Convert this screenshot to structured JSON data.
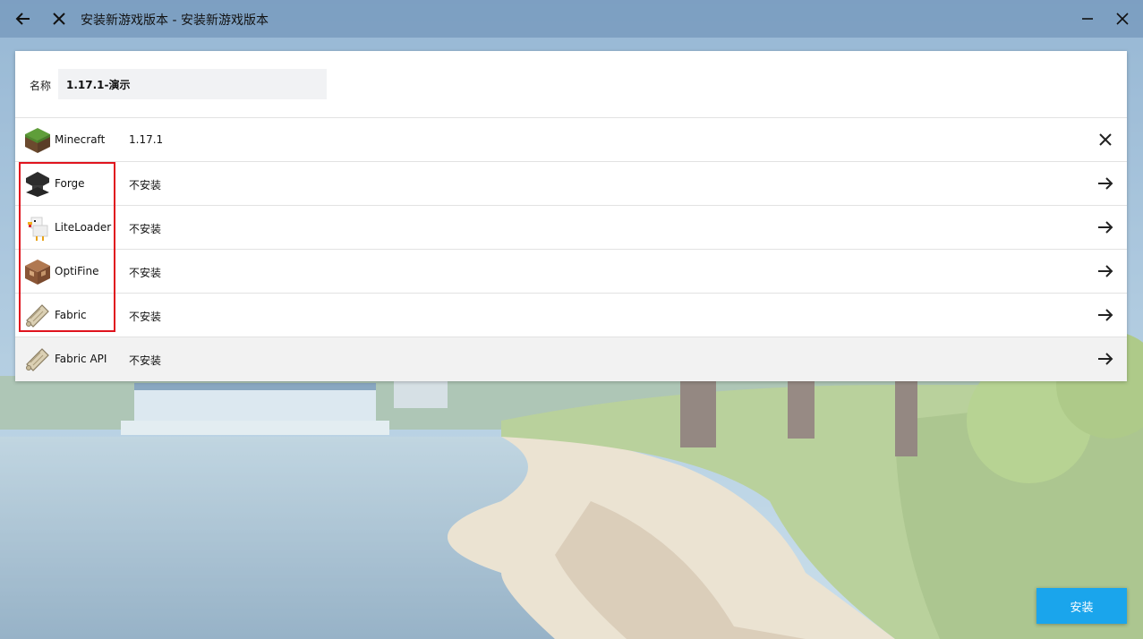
{
  "window": {
    "title": "安装新游戏版本 - 安装新游戏版本"
  },
  "icons": {
    "back": "arrow-left-icon",
    "close_window": "close-icon",
    "minimize": "minimize-icon",
    "close": "close-icon"
  },
  "name_field": {
    "label": "名称",
    "value": "1.17.1-演示"
  },
  "components": [
    {
      "name": "Minecraft",
      "value": "1.17.1",
      "icon": "grass-block-icon",
      "action": "remove-icon"
    },
    {
      "name": "Forge",
      "value": "不安装",
      "icon": "anvil-icon",
      "action": "arrow-right-icon"
    },
    {
      "name": "LiteLoader",
      "value": "不安装",
      "icon": "chicken-icon",
      "action": "arrow-right-icon"
    },
    {
      "name": "OptiFine",
      "value": "不安装",
      "icon": "command-block-icon",
      "action": "arrow-right-icon"
    },
    {
      "name": "Fabric",
      "value": "不安装",
      "icon": "fabric-scroll-icon",
      "action": "arrow-right-icon"
    },
    {
      "name": "Fabric API",
      "value": "不安装",
      "icon": "fabric-scroll-icon",
      "action": "arrow-right-icon"
    }
  ],
  "install_button": {
    "label": "安装"
  },
  "colors": {
    "accent": "#1aa5ec",
    "highlight_box": "#e0141e",
    "titlebar": "#6a8cb2"
  }
}
